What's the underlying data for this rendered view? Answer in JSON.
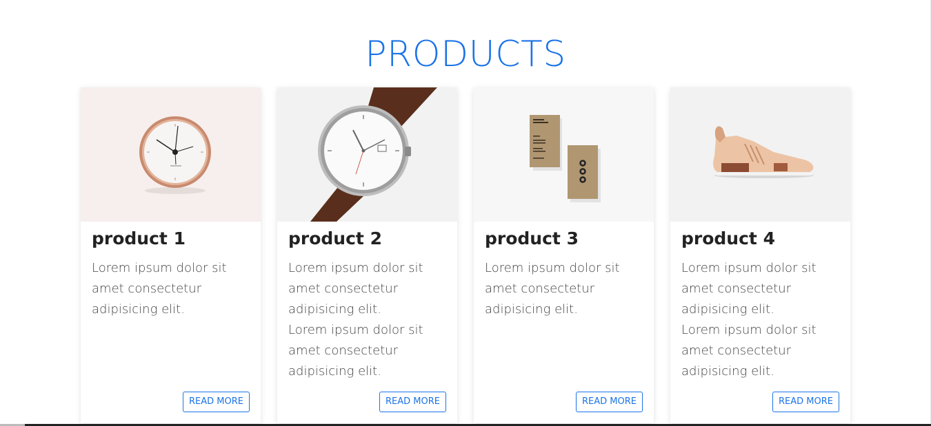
{
  "header": {
    "title": "PRODUCTS"
  },
  "colors": {
    "accent": "#1a73e8",
    "text": "#222222",
    "body_text": "#444444"
  },
  "products": [
    {
      "title": "product 1",
      "image": "wall-clock",
      "paragraphs": [
        "Lorem ipsum dolor sit amet consectetur adipisicing elit."
      ],
      "button": "READ MORE"
    },
    {
      "title": "product 2",
      "image": "wrist-watch",
      "paragraphs": [
        "Lorem ipsum dolor sit amet consectetur adipisicing elit.",
        "Lorem ipsum dolor sit amet consectetur adipisicing elit."
      ],
      "button": "READ MORE"
    },
    {
      "title": "product 3",
      "image": "business-cards",
      "paragraphs": [
        "Lorem ipsum dolor sit amet consectetur adipisicing elit."
      ],
      "button": "READ MORE"
    },
    {
      "title": "product 4",
      "image": "sneaker",
      "paragraphs": [
        "Lorem ipsum dolor sit amet consectetur adipisicing elit.",
        "Lorem ipsum dolor sit amet consectetur adipisicing elit."
      ],
      "button": "READ MORE"
    }
  ]
}
